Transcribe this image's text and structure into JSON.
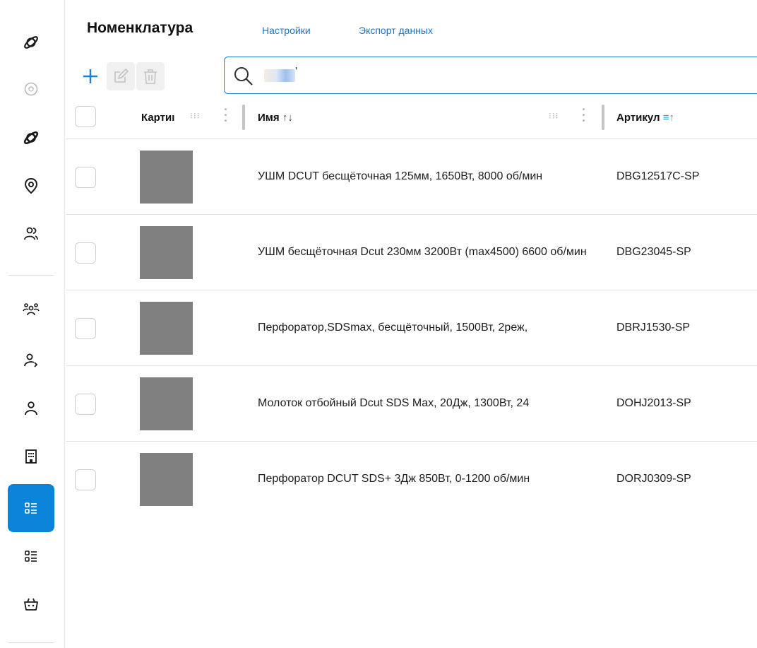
{
  "header": {
    "title": "Номенклатура",
    "links": [
      "Настройки",
      "Экспорт данных"
    ]
  },
  "toolbar": {
    "add_icon": "plus-icon",
    "edit_icon": "edit-icon",
    "delete_icon": "trash-icon"
  },
  "search": {
    "icon": "search-icon",
    "value": "'"
  },
  "sidebar": {
    "items": [
      {
        "icon": "planet-icon",
        "active": false
      },
      {
        "icon": "disc-icon",
        "active": false
      },
      {
        "icon": "planet-icon",
        "active": false
      },
      {
        "icon": "location-pin-icon",
        "active": false
      },
      {
        "icon": "users-icon",
        "active": false
      },
      {
        "icon": "group-icon",
        "active": false
      },
      {
        "icon": "user-add-icon",
        "active": false
      },
      {
        "icon": "user-icon",
        "active": false
      },
      {
        "icon": "building-icon",
        "active": false
      },
      {
        "icon": "list-icon",
        "active": true
      },
      {
        "icon": "list-icon",
        "active": false
      },
      {
        "icon": "basket-icon",
        "active": false
      }
    ],
    "active_color": "#0a84d8"
  },
  "table": {
    "columns": [
      {
        "label": "Картинка",
        "shown": "Картиı"
      },
      {
        "label": "Имя",
        "sort_icon": "↑↓"
      },
      {
        "label": "Артикул",
        "sort_icon": "≡↑"
      }
    ],
    "rows": [
      {
        "name": "УШМ DCUT бесщёточная 125мм, 1650Вт, 8000 об/мин",
        "sku": "DBG12517C-SP"
      },
      {
        "name": "УШМ бесщёточная Dcut 230мм 3200Вт (max4500) 6600 об/мин",
        "sku": "DBG23045-SP"
      },
      {
        "name": "Перфоратор,SDSmax, бесщёточный, 1500Вт, 2реж,",
        "sku": "DBRJ1530-SP"
      },
      {
        "name": "Молоток отбойный Dcut SDS Max, 20Дж, 1300Вт, 24",
        "sku": "DOHJ2013-SP"
      },
      {
        "name": "Перфоратор DCUT SDS+ 3Дж 850Вт, 0-1200 об/мин",
        "sku": "DORJ0309-SP"
      }
    ]
  },
  "colors": {
    "accent": "#0a84d8",
    "link": "#1a73c8",
    "thumb": "#808080"
  }
}
